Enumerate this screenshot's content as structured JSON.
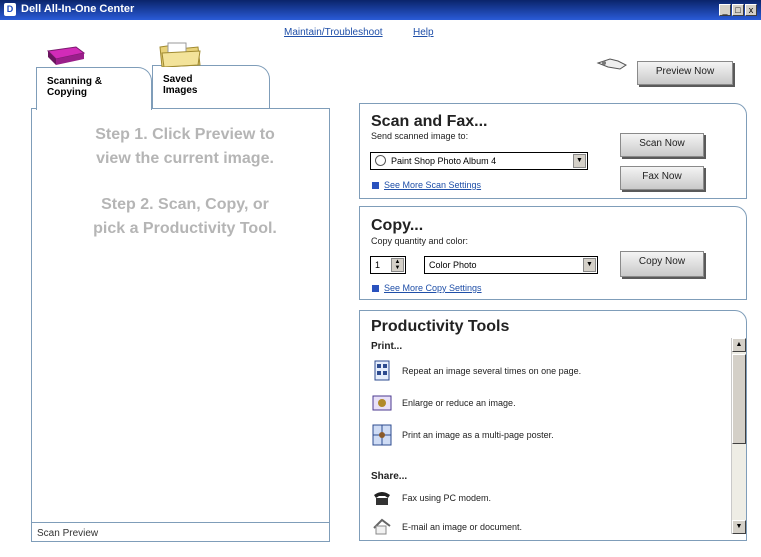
{
  "window": {
    "title": "Dell All-In-One Center",
    "controls": [
      "_",
      "□",
      "x"
    ]
  },
  "top_links": {
    "maintain": "Maintain/Troubleshoot",
    "help": "Help"
  },
  "tabs": [
    {
      "label_line1": "Scanning &",
      "label_line2": "Copying"
    },
    {
      "label_line1": "Saved",
      "label_line2": "Images"
    }
  ],
  "preview_panel": {
    "step1_line1": "Step 1.  Click Preview to",
    "step1_line2": "view the current image.",
    "step2_line1": "Step 2.  Scan, Copy, or",
    "step2_line2": "pick a Productivity Tool.",
    "status": "Scan Preview"
  },
  "preview_button": "Preview Now",
  "scan_fax": {
    "title": "Scan and Fax...",
    "send_label": "Send scanned image to:",
    "destination": "Paint Shop Photo Album 4",
    "more_settings": "See More Scan Settings",
    "scan_button": "Scan Now",
    "fax_button": "Fax Now"
  },
  "copy": {
    "title": "Copy...",
    "qty_label": "Copy quantity and color:",
    "quantity": "1",
    "color": "Color Photo",
    "more_settings": "See More Copy Settings",
    "copy_button": "Copy Now"
  },
  "productivity": {
    "title": "Productivity Tools",
    "print_heading": "Print...",
    "print_tools": [
      "Repeat an image several times on one page.",
      "Enlarge or reduce an image.",
      "Print an image as a multi-page poster."
    ],
    "share_heading": "Share...",
    "share_tools": [
      "Fax using PC modem.",
      "E-mail an image or document."
    ]
  },
  "colors": {
    "titlebar": "#0a246a",
    "link": "#1f4fa8",
    "border": "#7f9db9",
    "step_text": "#b5b5b5"
  }
}
